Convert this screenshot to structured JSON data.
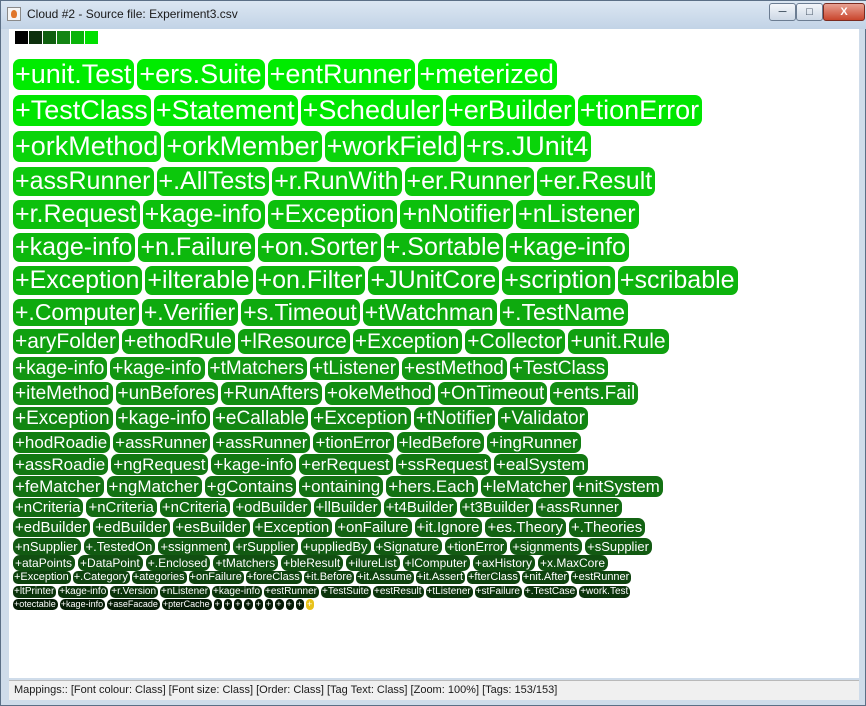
{
  "window": {
    "title": "Cloud #2 - Source file: Experiment3.csv",
    "min_label": "─",
    "max_label": "□",
    "close_label": "X"
  },
  "legend_colors": [
    "#000000",
    "#0d2f0d",
    "#0f5f0f",
    "#148514",
    "#0ab30a",
    "#00e000"
  ],
  "rows": [
    {
      "font_px": 27,
      "color": "#00ec00",
      "tags": [
        "+unit.Test",
        "+ers.Suite",
        "+entRunner",
        "+meterized"
      ]
    },
    {
      "font_px": 27,
      "color": "#00e600",
      "tags": [
        "+TestClass",
        "+Statement",
        "+Scheduler",
        "+erBuilder",
        "+tionError"
      ]
    },
    {
      "font_px": 27,
      "color": "#0ad40a",
      "tags": [
        "+orkMethod",
        "+orkMember",
        "+workField",
        "+rs.JUnit4"
      ]
    },
    {
      "font_px": 25,
      "color": "#0cc80c",
      "tags": [
        "+assRunner",
        "+.AllTests",
        "+r.RunWith",
        "+er.Runner",
        "+er.Result"
      ]
    },
    {
      "font_px": 25,
      "color": "#0cc00c",
      "tags": [
        "+r.Request",
        "+kage-info",
        "+Exception",
        "+nNotifier",
        "+nListener"
      ]
    },
    {
      "font_px": 25,
      "color": "#0db80d",
      "tags": [
        "+kage-info",
        "+n.Failure",
        "+on.Sorter",
        "+.Sortable",
        "+kage-info"
      ]
    },
    {
      "font_px": 25,
      "color": "#0db30d",
      "tags": [
        "+Exception",
        "+ilterable",
        "+on.Filter",
        "+JUnitCore",
        "+scription",
        "+scribable"
      ]
    },
    {
      "font_px": 23,
      "color": "#0eaa0e",
      "tags": [
        "+.Computer",
        "+.Verifier",
        "+s.Timeout",
        "+tWatchman",
        "+.TestName"
      ]
    },
    {
      "font_px": 21,
      "color": "#10a010",
      "tags": [
        "+aryFolder",
        "+ethodRule",
        "+lResource",
        "+Exception",
        "+Collector",
        "+unit.Rule"
      ]
    },
    {
      "font_px": 19,
      "color": "#129612",
      "tags": [
        "+kage-info",
        "+kage-info",
        "+tMatchers",
        "+tListener",
        "+estMethod",
        "+TestClass"
      ]
    },
    {
      "font_px": 19,
      "color": "#128e12",
      "tags": [
        "+iteMethod",
        "+unBefores",
        "+RunAfters",
        "+okeMethod",
        "+OnTimeout",
        "+ents.Fail"
      ]
    },
    {
      "font_px": 19,
      "color": "#128612",
      "tags": [
        "+Exception",
        "+kage-info",
        "+eCallable",
        "+Exception",
        "+tNotifier",
        "+Validator"
      ]
    },
    {
      "font_px": 17,
      "color": "#127e12",
      "tags": [
        "+hodRoadie",
        "+assRunner",
        "+assRunner",
        "+tionError",
        "+ledBefore",
        "+ingRunner"
      ]
    },
    {
      "font_px": 17,
      "color": "#127812",
      "tags": [
        "+assRoadie",
        "+ngRequest",
        "+kage-info",
        "+erRequest",
        "+ssRequest",
        "+ealSystem"
      ]
    },
    {
      "font_px": 17,
      "color": "#137213",
      "tags": [
        "+feMatcher",
        "+ngMatcher",
        "+gContains",
        "+ontaining",
        "+hers.Each",
        "+leMatcher",
        "+nitSystem"
      ]
    },
    {
      "font_px": 15,
      "color": "#136b13",
      "tags": [
        "+nCriteria",
        "+nCriteria",
        "+nCriteria",
        "+odBuilder",
        "+llBuilder",
        "+t4Builder",
        "+t3Builder",
        "+assRunner"
      ]
    },
    {
      "font_px": 15,
      "color": "#136313",
      "tags": [
        "+edBuilder",
        "+edBuilder",
        "+esBuilder",
        "+Exception",
        "+onFailure",
        "+it.Ignore",
        "+es.Theory",
        "+.Theories"
      ]
    },
    {
      "font_px": 13,
      "color": "#125a12",
      "tags": [
        "+nSupplier",
        "+.TestedOn",
        "+ssignment",
        "+rSupplier",
        "+uppliedBy",
        "+Signature",
        "+tionError",
        "+signments",
        "+sSupplier"
      ]
    },
    {
      "font_px": 12,
      "color": "#114f11",
      "tags": [
        "+ataPoints",
        "+DataPoint",
        "+.Enclosed",
        "+tMatchers",
        "+bleResult",
        "+ilureList",
        "+lComputer",
        "+axHistory",
        "+x.MaxCore"
      ]
    },
    {
      "font_px": 11,
      "color": "#0f430f",
      "tags": [
        "+Exception",
        "+.Category",
        "+ategories",
        "+onFailure",
        "+foreClass",
        "+it.Before",
        "+it.Assume",
        "+it.Assert",
        "+fterClass",
        "+nit.After",
        "+estRunner"
      ]
    },
    {
      "font_px": 10,
      "color": "#0b330b",
      "tags": [
        "+ltPrinter",
        "+kage-info",
        "+r.Version",
        "+nListener",
        "+kage-info",
        "+estRunner",
        "+TestSuite",
        "+estResult",
        "+tListener",
        "+stFailure",
        "+.TestCase",
        "+work.Test"
      ]
    },
    {
      "font_px": 9,
      "color": "#061c06",
      "tags": [
        "+otectable",
        "+kage-info",
        "+aseFacade",
        "+pterCache",
        "+",
        "+",
        "+",
        "+",
        "+",
        "+",
        "+",
        "+",
        "+",
        "+"
      ],
      "highlight_last_color": "#e8c21a"
    }
  ],
  "status": "Mappings:: [Font colour: Class]  [Font size: Class]  [Order: Class]  [Tag Text: Class]  [Zoom: 100%]  [Tags: 153/153]"
}
